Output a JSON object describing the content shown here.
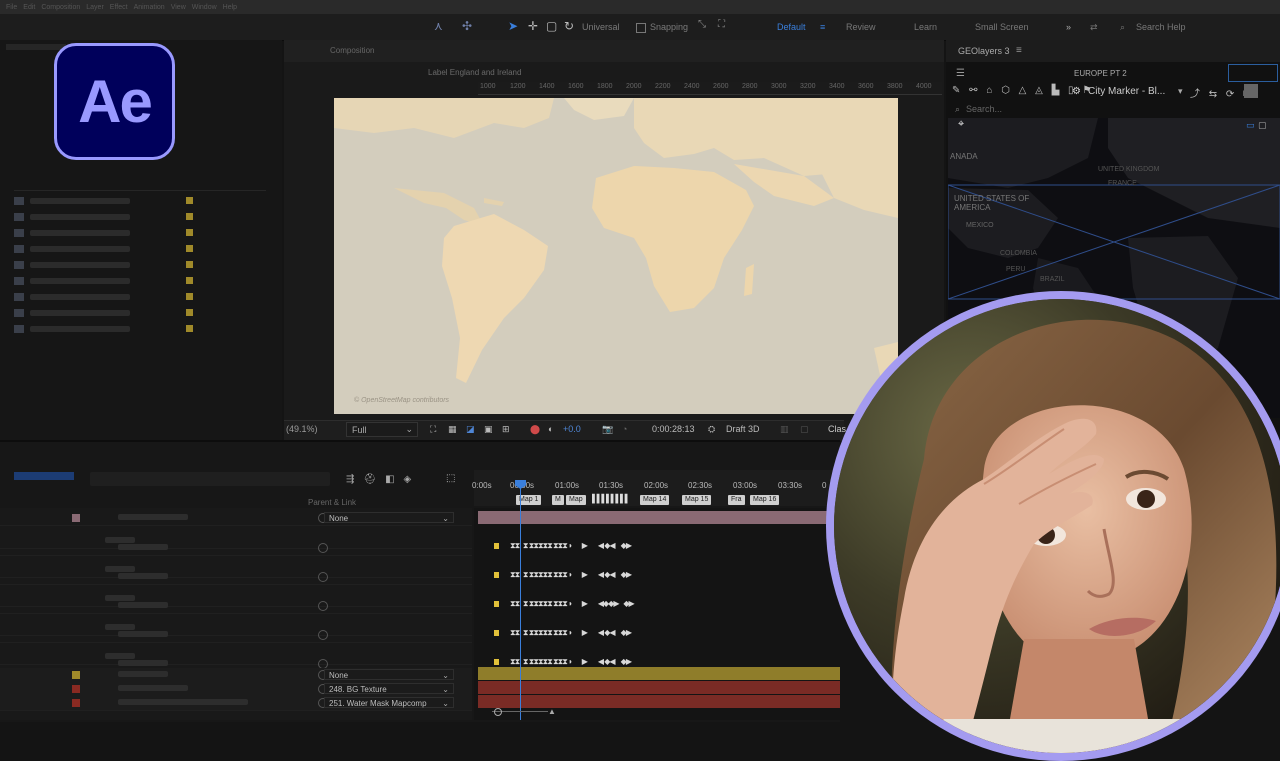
{
  "app": {
    "logo_text": "Ae",
    "menu": [
      "File",
      "Edit",
      "Composition",
      "Layer",
      "Effect",
      "Animation",
      "View",
      "Window",
      "Help"
    ]
  },
  "toolbar": {
    "universal_label": "Universal",
    "snapping_label": "Snapping",
    "workspaces": [
      "Default",
      "Review",
      "Learn",
      "Small Screen"
    ],
    "active_workspace": "Default",
    "search_placeholder": "Search Help"
  },
  "composition": {
    "tab_label": "Composition",
    "breadcrumb_label": "Label England and Ireland",
    "ruler_ticks": [
      "1000",
      "1200",
      "1400",
      "1600",
      "1800",
      "2000",
      "2200",
      "2400",
      "2600",
      "2800",
      "3000",
      "3200",
      "3400",
      "3600",
      "3800",
      "4000"
    ],
    "map_credit": "© OpenStreetMap contributors"
  },
  "viewer_footer": {
    "zoom": "(49.1%)",
    "resolution": "Full",
    "exposure": "+0.0",
    "timecode": "0:00:28:13",
    "renderer": "Draft 3D",
    "extra": "Clas"
  },
  "geolayers": {
    "panel_title": "GEOlayers 3",
    "comp_name": "EUROPE PT 2",
    "marker_style": "City Marker - Bl...",
    "search_placeholder": "Search...",
    "labels": [
      "ANADA",
      "UNITED KINGDOM",
      "FRANCE",
      "UNITED STATES OF AMERICA",
      "MEXICO",
      "COLOMBIA",
      "PERU",
      "BRAZIL"
    ]
  },
  "timeline": {
    "time_labels": [
      "0:00s",
      "00:30s",
      "01:00s",
      "01:30s",
      "02:00s",
      "02:30s",
      "03:00s",
      "03:30s",
      "0"
    ],
    "markers": [
      "Map 1",
      "M",
      "Map",
      "Map 14",
      "Map 15",
      "Fra",
      "Map 16"
    ],
    "columns": {
      "parent": "Parent & Link"
    },
    "parent_values": [
      "None",
      "None",
      "248. BG Texture",
      "251. Water Mask Mapcomp"
    ]
  },
  "colors": {
    "ae_purple": "#9999ff",
    "ae_navy": "#00005b",
    "accent_blue": "#3a7fdc",
    "bar_pink": "#8a6a74",
    "bar_gold": "#8f7d2a",
    "bar_red": "#7a2b25"
  }
}
